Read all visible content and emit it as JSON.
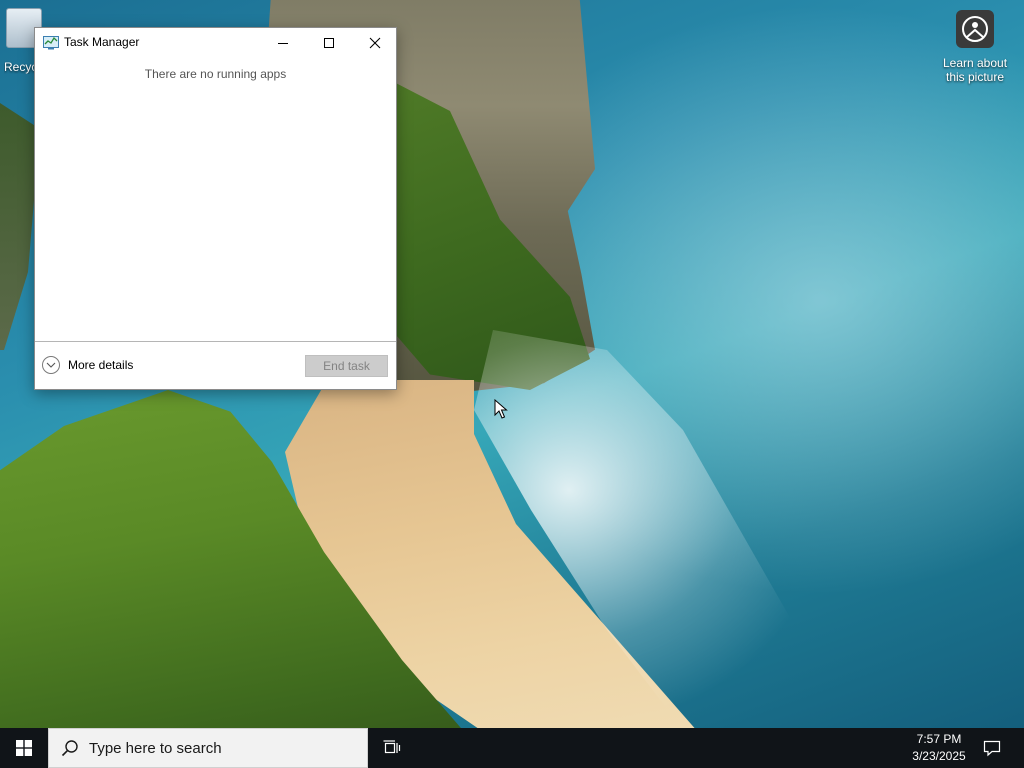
{
  "desktop": {
    "icons": [
      {
        "label": "Recycle Bin"
      },
      {
        "label": "Learn about this picture"
      }
    ]
  },
  "task_manager": {
    "title": "Task Manager",
    "empty_message": "There are no running apps",
    "more_details_label": "More details",
    "end_task_label": "End task",
    "end_task_enabled": false
  },
  "taskbar": {
    "search_placeholder": "Type here to search",
    "clock": {
      "time": "7:57 PM",
      "date": "3/23/2025"
    }
  },
  "colors": {
    "taskbar_bg": "#101418",
    "window_bg": "#ffffff",
    "disabled_button_bg": "#cccccc"
  }
}
